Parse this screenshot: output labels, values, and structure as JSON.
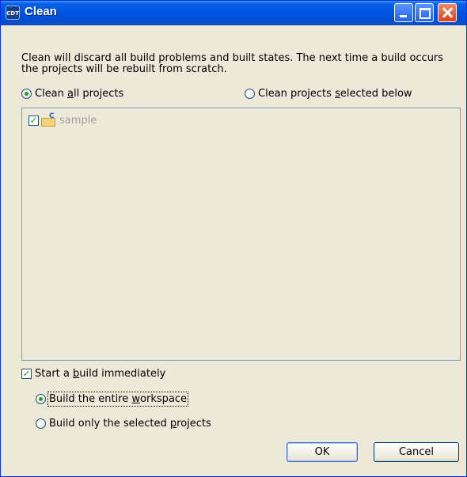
{
  "window": {
    "title": "Clean",
    "icon": "app-icon"
  },
  "description": "Clean will discard all build problems and built states.  The next time a build occurs the projects will be rebuilt from scratch.",
  "scope": {
    "all_projects": {
      "label_pre": "Clean ",
      "label_u": "a",
      "label_post": "ll projects",
      "selected": true
    },
    "selected_projects": {
      "label_pre": "Clean projects ",
      "label_u": "s",
      "label_post": "elected below",
      "selected": false
    }
  },
  "projects": [
    {
      "name": "sample",
      "checked": true,
      "icon": "c-project-folder-icon"
    }
  ],
  "build": {
    "start_immediately": {
      "label_pre": "Start a ",
      "label_u": "b",
      "label_post": "uild immediately",
      "checked": true
    },
    "entire_workspace": {
      "label_pre": "Build the entire ",
      "label_u": "w",
      "label_post": "orkspace",
      "selected": true
    },
    "selected_only": {
      "label_pre": "Build only the selected ",
      "label_u": "p",
      "label_post": "rojects",
      "selected": false
    }
  },
  "buttons": {
    "ok": "OK",
    "cancel": "Cancel"
  },
  "check_glyph": "✓"
}
